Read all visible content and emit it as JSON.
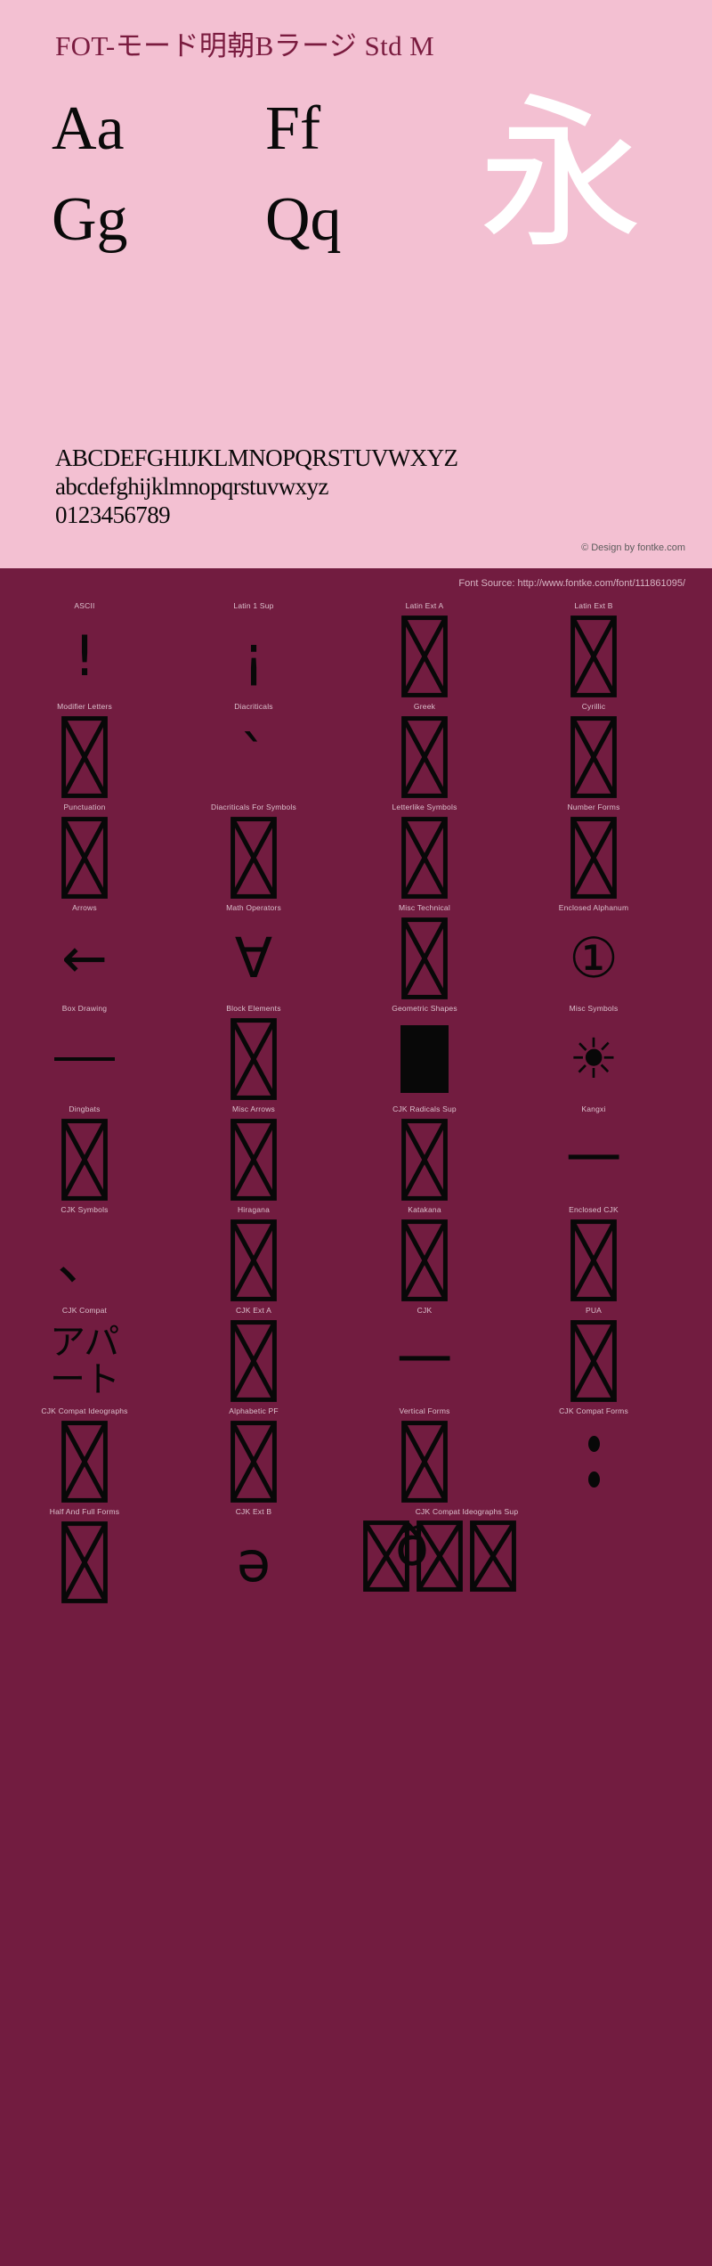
{
  "page": {
    "title": "FOT-モード明朝Bラージ Std M",
    "colors": {
      "panel_pink": "#f3c0d2",
      "panel_maroon": "#721c40",
      "title_maroon": "#7a1b3f",
      "glyph_black": "#080808",
      "kanji_white": "#ffffff",
      "label_pink": "#dcc1cd"
    }
  },
  "specimen": {
    "title": "FOT-モード明朝Bラージ Std M",
    "glyph_pairs": [
      {
        "left": "Aa",
        "right": "Ff"
      },
      {
        "left": "Gg",
        "right": "Qq"
      }
    ],
    "kanji": "永",
    "charset": {
      "uppercase": "ABCDEFGHIJKLMNOPQRSTUVWXYZ",
      "lowercase": "abcdefghijklmnopqrstuvwxyz",
      "digits": "0123456789"
    },
    "design_credit": "© Design by fontke.com"
  },
  "source": {
    "font_source": "Font Source: http://www.fontke.com/font/111861095/"
  },
  "unicode_blocks": {
    "rows": [
      [
        {
          "label": "ASCII",
          "sample": "!",
          "kind": "text"
        },
        {
          "label": "Latin 1 Sup",
          "sample": "¡",
          "kind": "text"
        },
        {
          "label": "Latin Ext A",
          "sample": "",
          "kind": "tofu"
        },
        {
          "label": "Latin Ext B",
          "sample": "",
          "kind": "tofu"
        }
      ],
      [
        {
          "label": "Modifier Letters",
          "sample": "",
          "kind": "tofu"
        },
        {
          "label": "Diacriticals",
          "sample": "ˋ",
          "kind": "text"
        },
        {
          "label": "Greek",
          "sample": "",
          "kind": "tofu"
        },
        {
          "label": "Cyrillic",
          "sample": "",
          "kind": "tofu"
        }
      ],
      [
        {
          "label": "Punctuation",
          "sample": "",
          "kind": "tofu"
        },
        {
          "label": "Diacriticals For Symbols",
          "sample": "",
          "kind": "tofu"
        },
        {
          "label": "Letterlike Symbols",
          "sample": "",
          "kind": "tofu"
        },
        {
          "label": "Number Forms",
          "sample": "",
          "kind": "tofu"
        }
      ],
      [
        {
          "label": "Arrows",
          "sample": "←",
          "kind": "text"
        },
        {
          "label": "Math Operators",
          "sample": "∀",
          "kind": "text"
        },
        {
          "label": "Misc Technical",
          "sample": "",
          "kind": "tofu"
        },
        {
          "label": "Enclosed Alphanum",
          "sample": "①",
          "kind": "text"
        }
      ],
      [
        {
          "label": "Box Drawing",
          "sample": "─",
          "kind": "hline"
        },
        {
          "label": "Block Elements",
          "sample": "",
          "kind": "tofu"
        },
        {
          "label": "Geometric Shapes",
          "sample": "■",
          "kind": "filled-square"
        },
        {
          "label": "Misc Symbols",
          "sample": "☀",
          "kind": "text"
        }
      ],
      [
        {
          "label": "Dingbats",
          "sample": "",
          "kind": "tofu"
        },
        {
          "label": "Misc Arrows",
          "sample": "",
          "kind": "tofu"
        },
        {
          "label": "CJK Radicals Sup",
          "sample": "",
          "kind": "tofu"
        },
        {
          "label": "Kangxi",
          "sample": "一",
          "kind": "text"
        }
      ],
      [
        {
          "label": "CJK Symbols",
          "sample": "、",
          "kind": "text"
        },
        {
          "label": "Hiragana",
          "sample": "",
          "kind": "tofu"
        },
        {
          "label": "Katakana",
          "sample": "",
          "kind": "tofu"
        },
        {
          "label": "Enclosed CJK",
          "sample": "",
          "kind": "tofu"
        }
      ],
      [
        {
          "label": "CJK Compat",
          "sample": "アパ\nート",
          "kind": "kana"
        },
        {
          "label": "CJK Ext A",
          "sample": "",
          "kind": "tofu"
        },
        {
          "label": "CJK",
          "sample": "一",
          "kind": "text"
        },
        {
          "label": "PUA",
          "sample": "",
          "kind": "tofu"
        }
      ],
      [
        {
          "label": "CJK Compat Ideographs",
          "sample": "",
          "kind": "tofu"
        },
        {
          "label": "Alphabetic PF",
          "sample": "",
          "kind": "tofu"
        },
        {
          "label": "Vertical Forms",
          "sample": "",
          "kind": "tofu"
        },
        {
          "label": "CJK Compat Forms",
          "sample": "·",
          "kind": "dots"
        }
      ],
      [
        {
          "label": "Half And Full Forms",
          "sample": "",
          "kind": "tofu"
        },
        {
          "label": "CJK Ext B",
          "sample": "ə",
          "kind": "text"
        },
        {
          "label": "CJK Compat Ideographs Sup",
          "sample": "ð",
          "kind": "stacked"
        }
      ]
    ]
  }
}
